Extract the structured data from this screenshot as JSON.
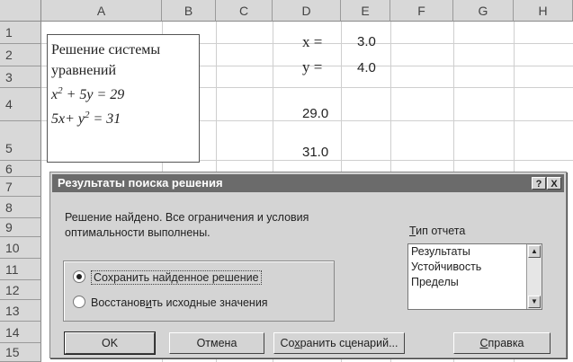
{
  "sheet": {
    "columns": [
      "A",
      "B",
      "C",
      "D",
      "E",
      "F",
      "G",
      "H"
    ],
    "rows": [
      "1",
      "2",
      "3",
      "4",
      "5",
      "6",
      "7",
      "8",
      "9",
      "10",
      "11",
      "12",
      "13",
      "14",
      "15"
    ],
    "textbox": {
      "line1": "Решение системы",
      "line2": "уравнений",
      "eq1_a": "x",
      "eq1_exp": "2",
      "eq1_b": " + 5y = 29",
      "eq2_a": "5x+ y",
      "eq2_exp": "2",
      "eq2_b": " = 31"
    },
    "cells": {
      "d1": "x =",
      "e1": "3.0",
      "d2": "y =",
      "e2": "4.0",
      "d4": "29.0",
      "d5": "31.0"
    }
  },
  "dialog": {
    "title": "Результаты поиска решения",
    "help_btn": "?",
    "close_btn": "X",
    "message_line1": "Решение найдено. Все ограничения и условия",
    "message_line2": "оптимальности выполнены.",
    "options": {
      "keep": "Сохранить найденное решение",
      "restore_pre": "Восстанов",
      "restore_u": "и",
      "restore_post": "ть исходные значения"
    },
    "report_type": {
      "u": "Т",
      "rest": "ип отчета"
    },
    "reports": [
      "Результаты",
      "Устойчивость",
      "Пределы"
    ],
    "buttons": {
      "ok": "OK",
      "cancel": "Отмена",
      "save_pre": "Со",
      "save_u": "х",
      "save_post": "ранить сценарий...",
      "help_u": "С",
      "help_rest": "правка"
    }
  }
}
